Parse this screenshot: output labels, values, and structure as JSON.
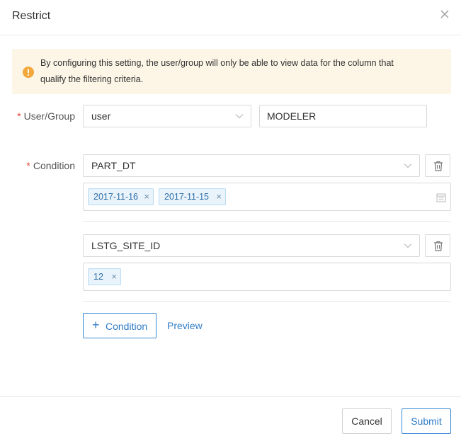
{
  "dialog": {
    "title": "Restrict"
  },
  "alert": {
    "line1": "By configuring this setting, the user/group will only be able to view data for the column that",
    "line2": "qualify the filtering criteria.",
    "icon": "warning-icon",
    "background_color": "#fdf6e7",
    "icon_color": "#f2a83c"
  },
  "user_group": {
    "label": "User/Group",
    "required_mark": "*",
    "type_value": "user",
    "name_value": "MODELER"
  },
  "condition": {
    "label": "Condition",
    "required_mark": "*",
    "rows": [
      {
        "column": "PART_DT",
        "values": [
          "2017-11-16",
          "2017-11-15"
        ],
        "has_calendar": true
      },
      {
        "column": "LSTG_SITE_ID",
        "values": [
          "12"
        ],
        "has_calendar": false
      }
    ],
    "add_label": "Condition",
    "preview_label": "Preview"
  },
  "footer": {
    "cancel_label": "Cancel",
    "submit_label": "Submit"
  },
  "colors": {
    "accent": "#2f7cc7",
    "required": "#e8443a",
    "tag_bg": "#e8f3fb"
  }
}
